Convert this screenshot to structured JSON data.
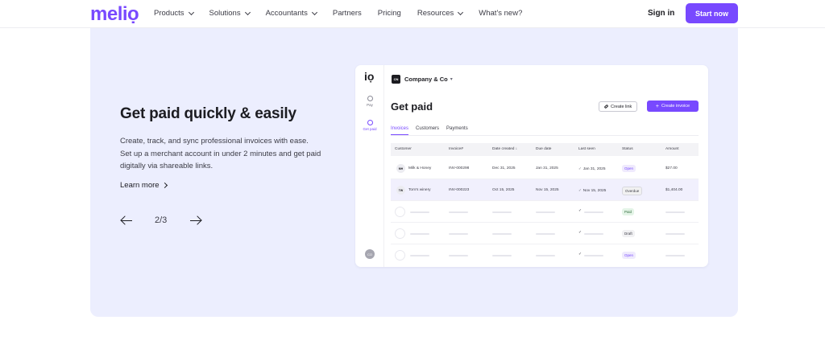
{
  "nav": {
    "logo": "meliọ",
    "links": [
      {
        "label": "Products",
        "dropdown": true
      },
      {
        "label": "Solutions",
        "dropdown": true
      },
      {
        "label": "Accountants",
        "dropdown": true
      },
      {
        "label": "Partners",
        "dropdown": false
      },
      {
        "label": "Pricing",
        "dropdown": false
      },
      {
        "label": "Resources",
        "dropdown": true
      },
      {
        "label": "What's new?",
        "dropdown": false
      }
    ],
    "signin": "Sign in",
    "cta": "Start now"
  },
  "hero": {
    "title": "Get paid quickly & easily",
    "description": "Create, track, and sync professional invoices with ease. Set up a merchant account in under 2 minutes and get paid digitally via shareable links.",
    "learn_more": "Learn more",
    "pager": "2/3"
  },
  "app": {
    "logo": "iọ",
    "sidebar": [
      {
        "label": "Pay",
        "active": false
      },
      {
        "label": "Get paid",
        "active": true
      }
    ],
    "avatar": "CO",
    "company_badge": "CN",
    "company": "Company & Co",
    "page_title": "Get paid",
    "create_link": "Create link",
    "create_invoice": "Create invoice",
    "tabs": [
      {
        "label": "Invoices",
        "active": true
      },
      {
        "label": "Customers",
        "active": false
      },
      {
        "label": "Payments",
        "active": false
      }
    ],
    "columns": [
      "Customer",
      "Invoice#",
      "Date created ↓",
      "Due date",
      "Last seen",
      "Status",
      "Amount"
    ],
    "rows": [
      {
        "initials": "MH",
        "customer": "Milk & Honey",
        "invoice": "INV-000298",
        "created": "Dec 31, 2025",
        "due": "Jan 31, 2025",
        "seen": "Jan 31, 2025",
        "status": "Open",
        "status_type": "open",
        "amount": "$27.00",
        "highlight": false
      },
      {
        "initials": "TW",
        "customer": "Tom's winery",
        "invoice": "INV-000223",
        "created": "Oct 15, 2025",
        "due": "Nov 15, 2025",
        "seen": "Nov 15, 2025",
        "status": "Overdue",
        "status_type": "overdue",
        "amount": "$1,404.00",
        "highlight": true
      }
    ],
    "placeholder_statuses": [
      {
        "status": "Paid",
        "status_type": "paid"
      },
      {
        "status": "Draft",
        "status_type": "draft"
      },
      {
        "status": "Open",
        "status_type": "open"
      }
    ]
  }
}
